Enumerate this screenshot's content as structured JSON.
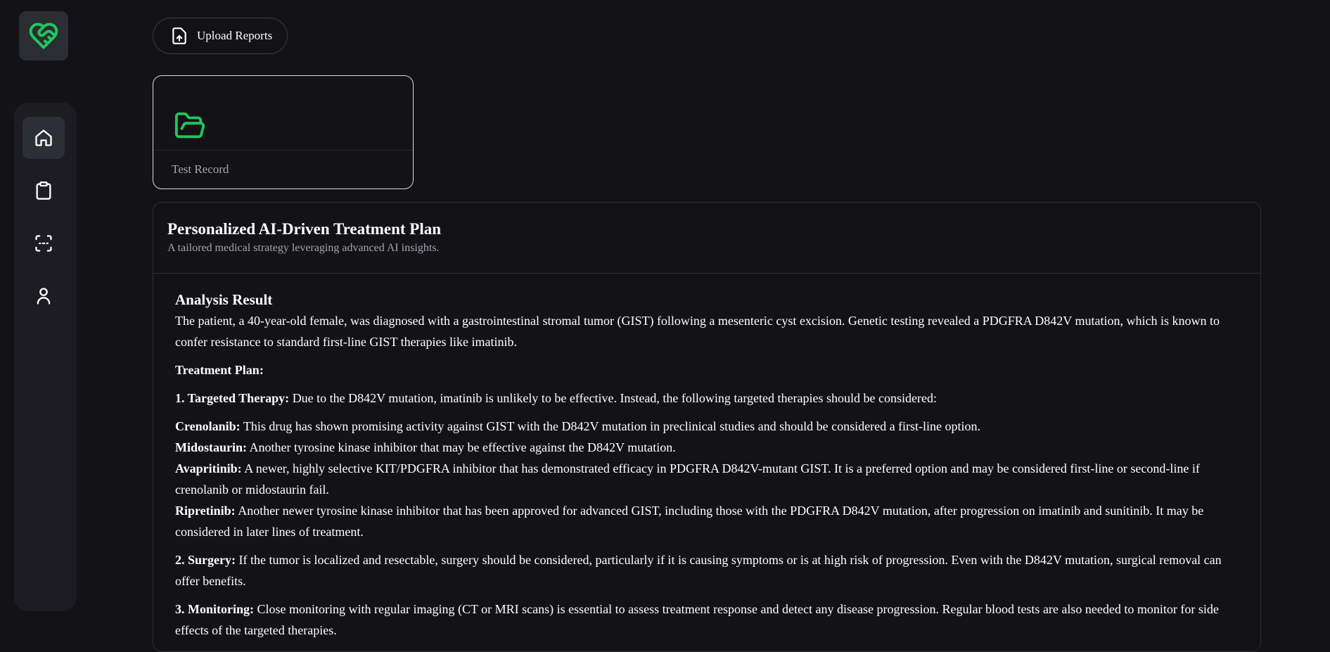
{
  "sidebar": {
    "logo_icon": "heart-handshake-icon",
    "items": [
      {
        "name": "home",
        "icon": "home-icon",
        "active": true
      },
      {
        "name": "records",
        "icon": "clipboard-icon",
        "active": false
      },
      {
        "name": "scan",
        "icon": "scan-icon",
        "active": false
      },
      {
        "name": "profile",
        "icon": "user-icon",
        "active": false
      }
    ]
  },
  "toolbar": {
    "upload_label": "Upload Reports",
    "upload_icon": "upload-file-icon"
  },
  "record": {
    "label": "Test Record",
    "icon": "folder-open-icon"
  },
  "plan": {
    "title": "Personalized AI-Driven Treatment Plan",
    "subtitle": "A tailored medical strategy leveraging advanced AI insights.",
    "analysis_heading": "Analysis Result",
    "intro": "The patient, a 40-year-old female, was diagnosed with a gastrointestinal stromal tumor (GIST) following a mesenteric cyst excision. Genetic testing revealed a PDGFRA D842V mutation, which is known to confer resistance to standard first-line GIST therapies like imatinib.",
    "treatment_heading": "Treatment Plan:",
    "section1_label": "1. Targeted Therapy:",
    "section1_text": " Due to the D842V mutation, imatinib is unlikely to be effective. Instead, the following targeted therapies should be considered:",
    "drugs": [
      {
        "name": "Crenolanib:",
        "text": " This drug has shown promising activity against GIST with the D842V mutation in preclinical studies and should be considered a first-line option."
      },
      {
        "name": "Midostaurin:",
        "text": " Another tyrosine kinase inhibitor that may be effective against the D842V mutation."
      },
      {
        "name": "Avapritinib:",
        "text": " A newer, highly selective KIT/PDGFRA inhibitor that has demonstrated efficacy in PDGFRA D842V-mutant GIST. It is a preferred option and may be considered first-line or second-line if crenolanib or midostaurin fail."
      },
      {
        "name": "Ripretinib:",
        "text": " Another newer tyrosine kinase inhibitor that has been approved for advanced GIST, including those with the PDGFRA D842V mutation, after progression on imatinib and sunitinib. It may be considered in later lines of treatment."
      }
    ],
    "section2_label": "2. Surgery:",
    "section2_text": " If the tumor is localized and resectable, surgery should be considered, particularly if it is causing symptoms or is at high risk of progression. Even with the D842V mutation, surgical removal can offer benefits.",
    "section3_label": "3. Monitoring:",
    "section3_text": " Close monitoring with regular imaging (CT or MRI scans) is essential to assess treatment response and detect any disease progression. Regular blood tests are also needed to monitor for side effects of the targeted therapies."
  },
  "colors": {
    "accent": "#22c55e",
    "background": "#131317",
    "sidebar": "#1c1c22"
  }
}
